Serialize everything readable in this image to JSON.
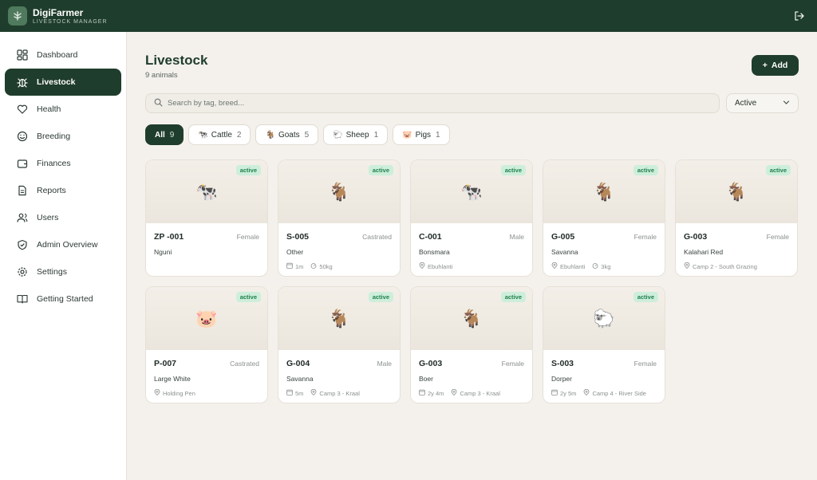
{
  "app": {
    "name": "DigiFarmer",
    "subtitle": "LIVESTOCK MANAGER"
  },
  "sidebar": {
    "items": [
      {
        "label": "Dashboard",
        "icon": "grid-icon"
      },
      {
        "label": "Livestock",
        "icon": "bug-icon",
        "active": true
      },
      {
        "label": "Health",
        "icon": "heart-icon"
      },
      {
        "label": "Breeding",
        "icon": "smile-icon"
      },
      {
        "label": "Finances",
        "icon": "wallet-icon"
      },
      {
        "label": "Reports",
        "icon": "file-icon"
      },
      {
        "label": "Users",
        "icon": "users-icon"
      },
      {
        "label": "Admin Overview",
        "icon": "shield-icon"
      },
      {
        "label": "Settings",
        "icon": "gear-icon"
      },
      {
        "label": "Getting Started",
        "icon": "book-icon"
      }
    ]
  },
  "header": {
    "title": "Livestock",
    "subtitle": "9 animals",
    "add_label": "Add"
  },
  "search": {
    "placeholder": "Search by tag, breed..."
  },
  "status_select": {
    "value": "Active"
  },
  "filters": [
    {
      "label": "All",
      "count": "9",
      "emoji": ""
    },
    {
      "label": "Cattle",
      "count": "2",
      "emoji": "🐄"
    },
    {
      "label": "Goats",
      "count": "5",
      "emoji": "🐐"
    },
    {
      "label": "Sheep",
      "count": "1",
      "emoji": "🐑"
    },
    {
      "label": "Pigs",
      "count": "1",
      "emoji": "🐷"
    }
  ],
  "animals": [
    {
      "tag": "ZP -001",
      "sex": "Female",
      "breed": "Nguni",
      "emoji": "🐄",
      "status": "active",
      "age": "",
      "weight": "",
      "location": ""
    },
    {
      "tag": "S-005",
      "sex": "Castrated",
      "breed": "Other",
      "emoji": "🐐",
      "status": "active",
      "age": "1m",
      "weight": "50kg",
      "location": ""
    },
    {
      "tag": "C-001",
      "sex": "Male",
      "breed": "Bonsmara",
      "emoji": "🐄",
      "status": "active",
      "age": "",
      "weight": "",
      "location": "Ebuhlanti"
    },
    {
      "tag": "G-005",
      "sex": "Female",
      "breed": "Savanna",
      "emoji": "🐐",
      "status": "active",
      "age": "",
      "weight": "3kg",
      "location": "Ebuhlanti"
    },
    {
      "tag": "G-003",
      "sex": "Female",
      "breed": "Kalahari Red",
      "emoji": "🐐",
      "status": "active",
      "age": "",
      "weight": "",
      "location": "Camp 2 - South Grazing"
    },
    {
      "tag": "P-007",
      "sex": "Castrated",
      "breed": "Large White",
      "emoji": "🐷",
      "status": "active",
      "age": "",
      "weight": "",
      "location": "Holding Pen"
    },
    {
      "tag": "G-004",
      "sex": "Male",
      "breed": "Savanna",
      "emoji": "🐐",
      "status": "active",
      "age": "5m",
      "weight": "",
      "location": "Camp 3 - Kraal"
    },
    {
      "tag": "G-003",
      "sex": "Female",
      "breed": "Boer",
      "emoji": "🐐",
      "status": "active",
      "age": "2y 4m",
      "weight": "",
      "location": "Camp 3 - Kraal"
    },
    {
      "tag": "S-003",
      "sex": "Female",
      "breed": "Dorper",
      "emoji": "🐑",
      "status": "active",
      "age": "2y 5m",
      "weight": "",
      "location": "Camp 4 - River Side"
    }
  ],
  "colors": {
    "primary": "#1f3d2c",
    "badge_bg": "#cdeedb",
    "badge_text": "#21804e",
    "background": "#f4f1ec"
  }
}
